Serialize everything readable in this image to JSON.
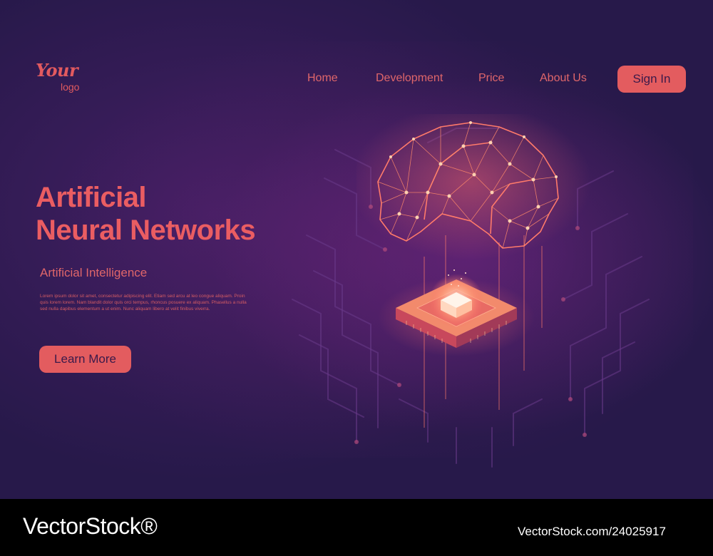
{
  "logo": {
    "text": "Your",
    "sub": "logo"
  },
  "nav": {
    "home": "Home",
    "development": "Development",
    "price": "Price",
    "about": "About Us",
    "sign_in": "Sign In"
  },
  "hero": {
    "title_line1": "Artificial",
    "title_line2": "Neural Networks",
    "subtitle": "Artificial Intelligence",
    "body": "Lorem ipsum dolor sit amet, consectetur adipiscing elit. Etiam sed arcu at leo congue aliquam. Proin quis lorem lorem. Nam blandit dolor quis orci tempus, rhoncus posuere ex aliquam. Phasellus a nulla sed nulla dapibus elementum a ut enim. Nunc aliquam libero at velit finibus viverra.",
    "cta": "Learn More"
  },
  "watermark": {
    "brand": "VectorStock®",
    "id": "VectorStock.com/24025917"
  },
  "colors": {
    "accent": "#e35c5f",
    "background": "#27194a",
    "footer": "#000000"
  },
  "icons": [
    "brain-network-illustration",
    "processor-chip-illustration",
    "circuit-lines-decoration"
  ]
}
